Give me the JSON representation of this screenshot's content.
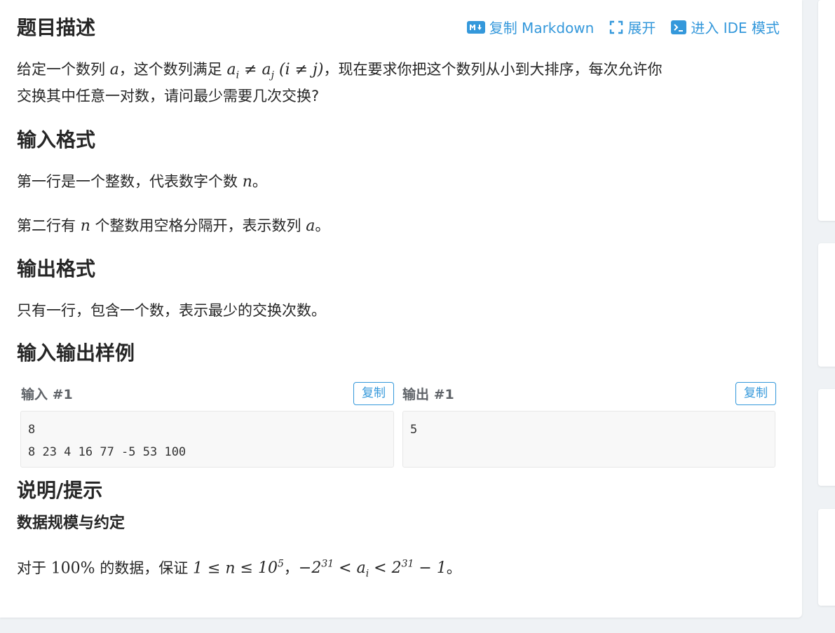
{
  "toolbar": {
    "copy_markdown": "复制 Markdown",
    "expand": "展开",
    "ide_mode": "进入 IDE 模式"
  },
  "description": {
    "title": "题目描述",
    "line1_a": "给定一个数列 ",
    "line1_b": "，这个数列满足 ",
    "line1_c": "，现在要求你把这个数列从小到大排序，每次允许你",
    "line2": "交换其中任意一对数，请问最少需要几次交换?"
  },
  "input_format": {
    "title": "输入格式",
    "line1_a": "第一行是一个整数，代表数字个数 ",
    "line1_b": "。",
    "line2_a": "第二行有 ",
    "line2_b": " 个整数用空格分隔开，表示数列 ",
    "line2_c": "。"
  },
  "output_format": {
    "title": "输出格式",
    "line1": "只有一行，包含一个数，表示最少的交换次数。"
  },
  "samples": {
    "title": "输入输出样例",
    "input_label": "输入 #1",
    "output_label": "输出 #1",
    "copy_label": "复制",
    "input_text": "8\n8 23 4 16 77 -5 53 100",
    "output_text": "5"
  },
  "hint": {
    "title": "说明/提示",
    "subtitle": "数据规模与约定",
    "line_a": "对于 ",
    "line_b": " 的数据，保证 ",
    "line_c": "，",
    "line_d": "。"
  },
  "colors": {
    "accent": "#3498db",
    "text": "#262626",
    "background": "#eff2f5"
  }
}
